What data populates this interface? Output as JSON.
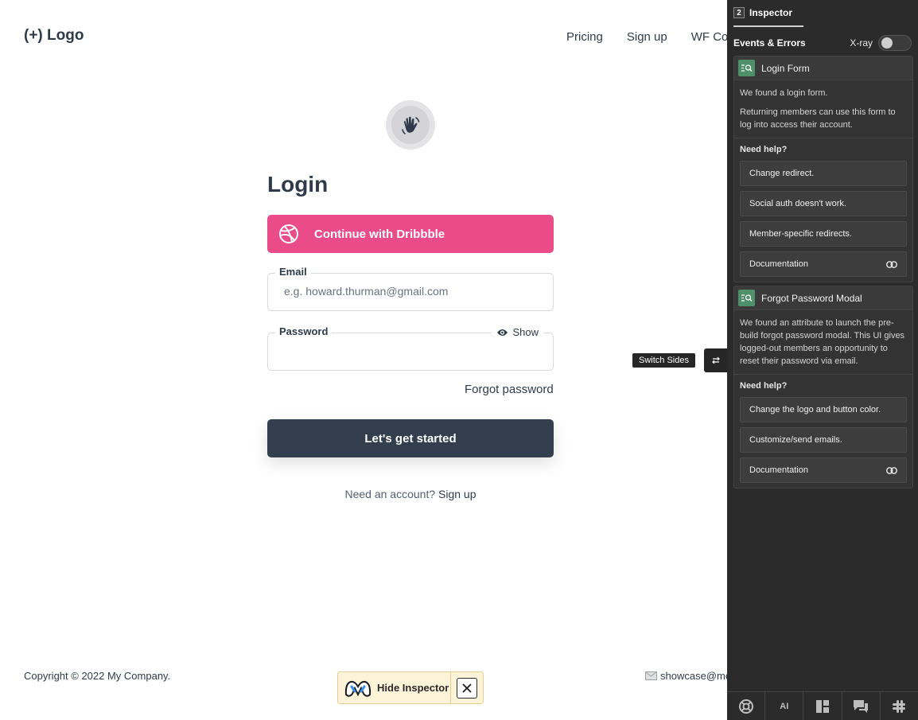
{
  "header": {
    "logo": "(+) Logo",
    "nav": [
      "Pricing",
      "Sign up",
      "WF Co"
    ]
  },
  "form": {
    "title": "Login",
    "dribbble_label": "Continue with Dribbble",
    "email_label": "Email",
    "email_placeholder": "e.g. howard.thurman@gmail.com",
    "password_label": "Password",
    "show_label": "Show",
    "forgot_label": "Forgot password",
    "submit_label": "Let's get started",
    "signup_prompt": "Need an account?",
    "signup_link": "Sign up"
  },
  "footer": {
    "copyright": "Copyright © 2022 My Company.",
    "email": "showcase@me"
  },
  "hide_inspector_label": "Hide Inspector",
  "switch_sides_label": "Switch Sides",
  "inspector": {
    "count": "2",
    "tab_label": "Inspector",
    "events_label": "Events & Errors",
    "xray_label": "X-ray",
    "xray_on": false,
    "cards": [
      {
        "title": "Login Form",
        "desc": [
          "We found a login form.",
          "Returning members can use this form to log into access their account."
        ],
        "help_title": "Need help?",
        "items": [
          "Change redirect.",
          "Social auth doesn't work.",
          "Member-specific redirects.",
          "Documentation"
        ]
      },
      {
        "title": "Forgot Password Modal",
        "desc": [
          "We found an attribute to launch the pre-build forgot password modal. This UI gives logged-out members an opportunity to reset their password via email."
        ],
        "help_title": "Need help?",
        "items": [
          "Change the logo and button color.",
          "Customize/send emails.",
          "Documentation"
        ]
      }
    ],
    "bottom_bar": [
      "support-icon",
      "AI",
      "layout-icon",
      "chat-icon",
      "slack-icon"
    ]
  },
  "colors": {
    "dribbble": "#ea4c89",
    "primary_button": "#333f4e",
    "panel_bg": "#2b2b2b",
    "card_icon": "#4f8f6a"
  }
}
